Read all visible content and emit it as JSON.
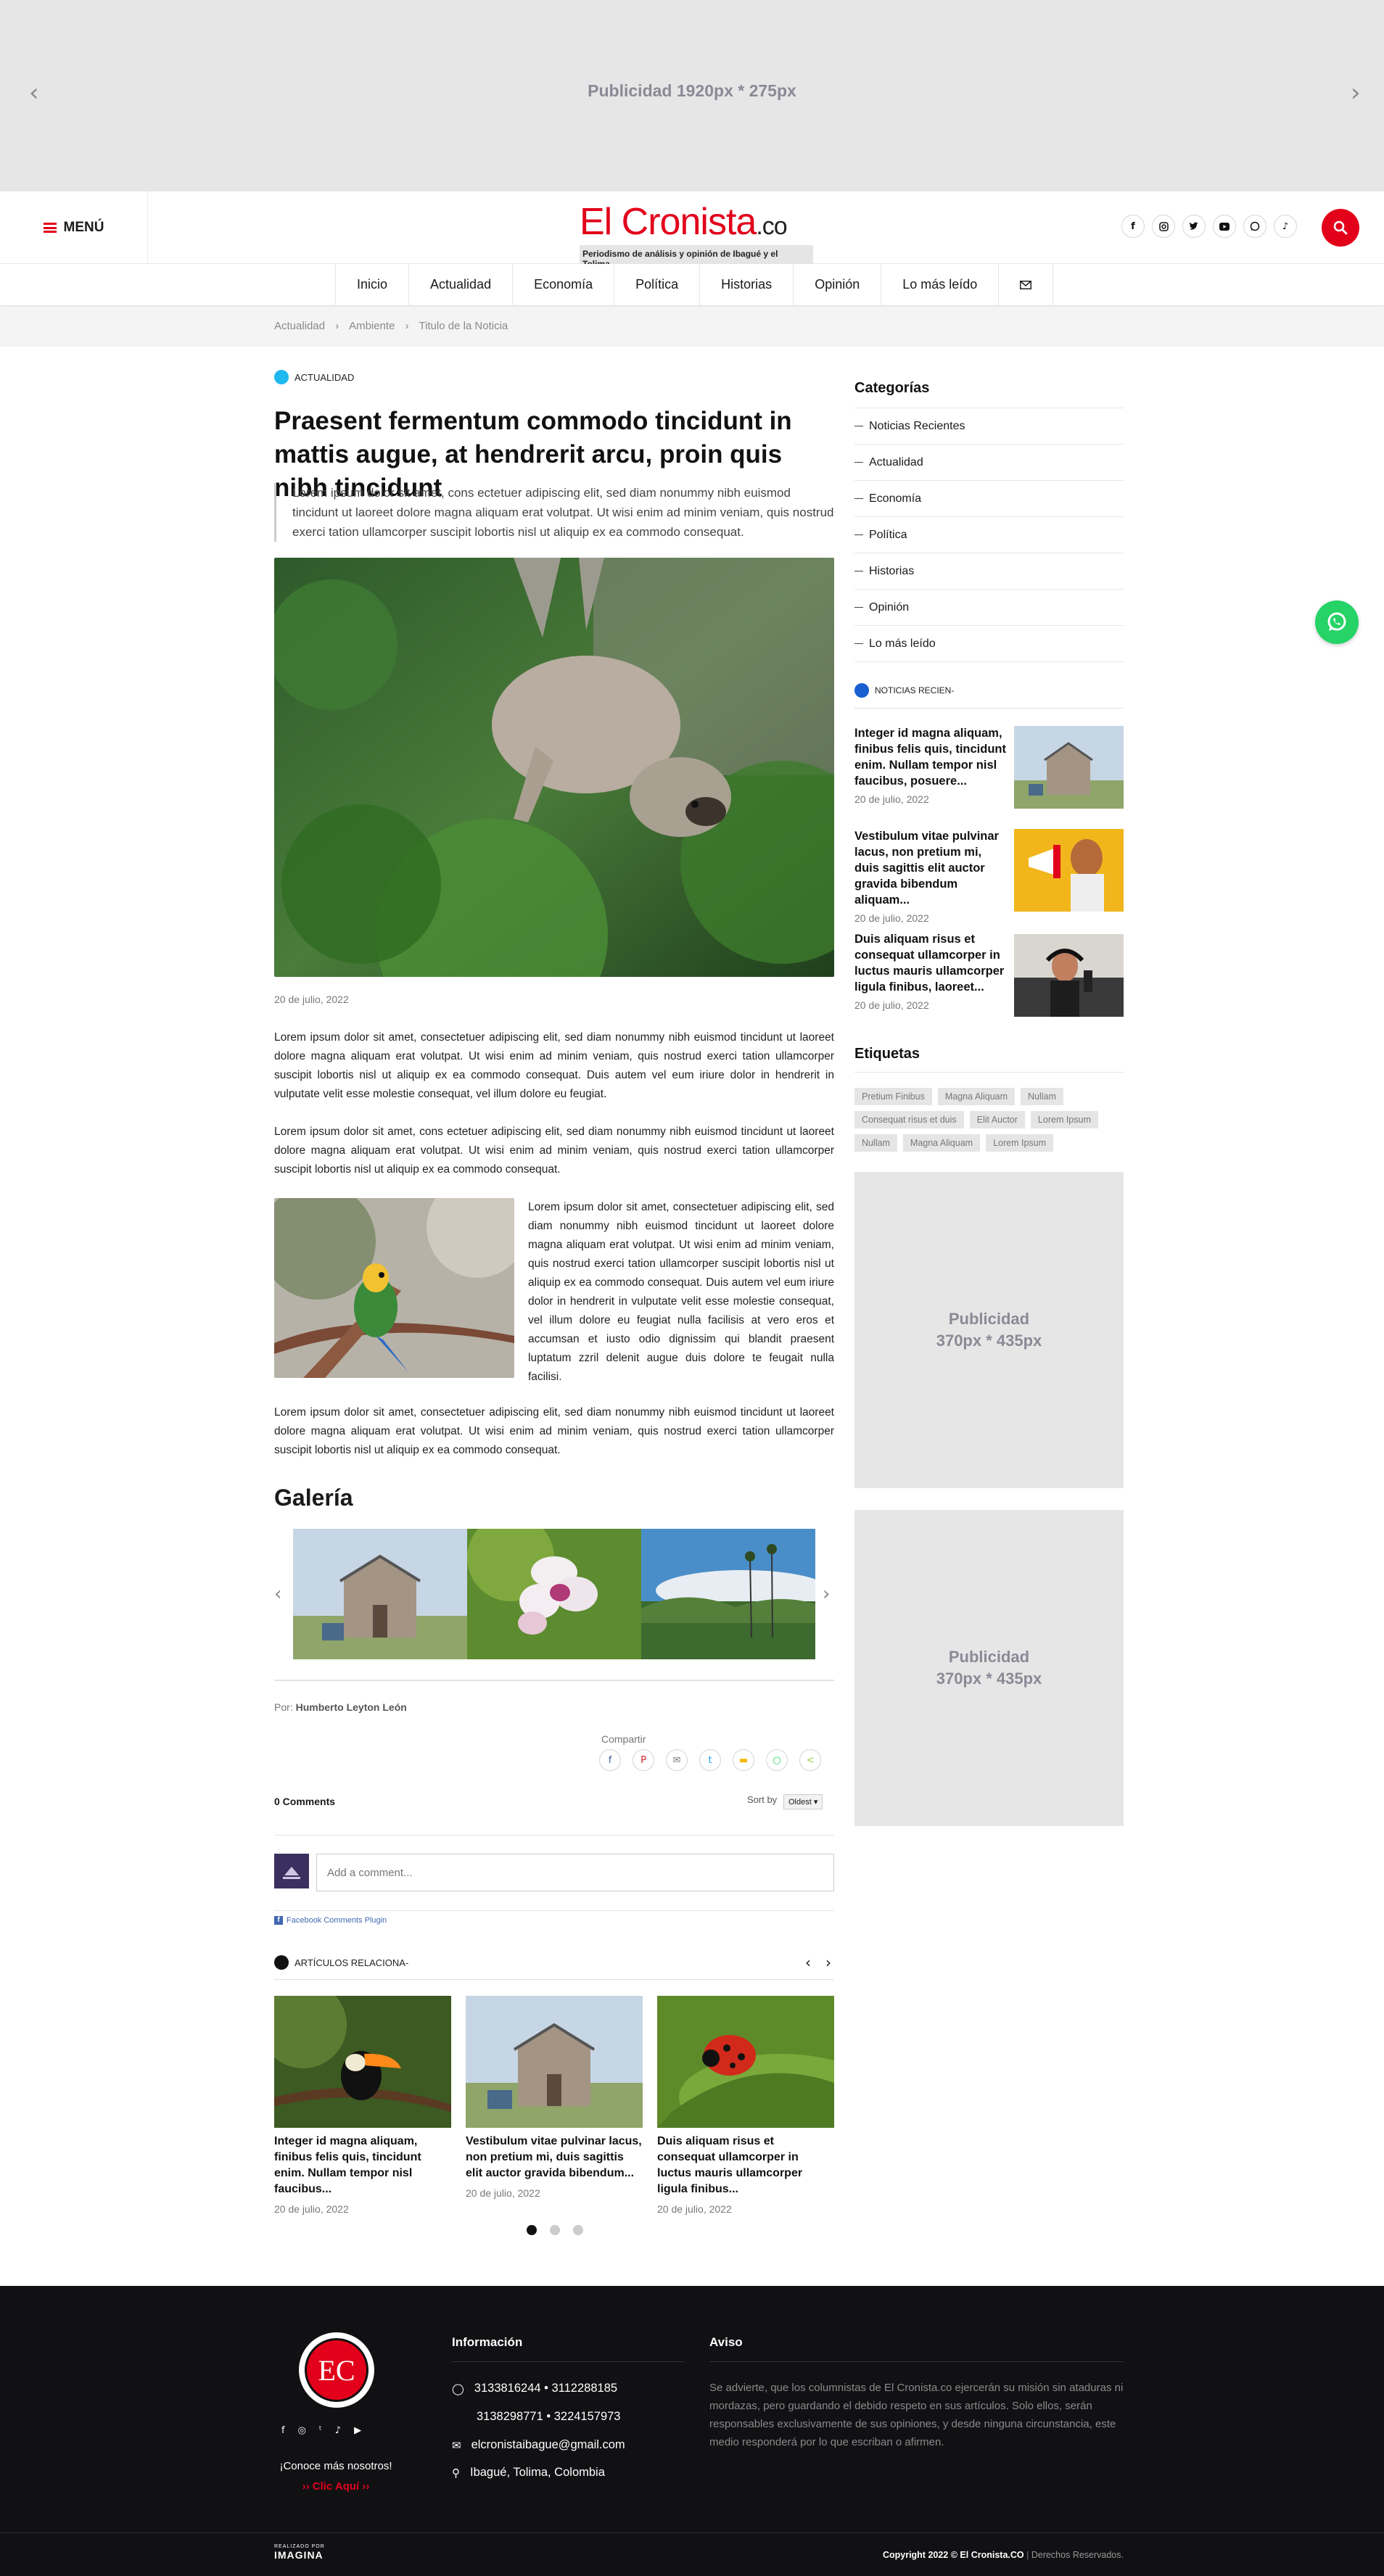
{
  "top_ad": {
    "text": "Publicidad 1920px * 275px",
    "prev": "‹",
    "next": "›"
  },
  "header": {
    "menu_label": "MENÚ",
    "logo_main": "El Cronista",
    "logo_suffix": ".co",
    "logo_tagline": "Periodismo de análisis y opinión de Ibagué y el Tolima",
    "social_icons": [
      "facebook-icon",
      "instagram-icon",
      "twitter-icon",
      "youtube-icon",
      "whatsapp-icon",
      "tiktok-icon"
    ]
  },
  "nav": {
    "items": [
      "Inicio",
      "Actualidad",
      "Economía",
      "Política",
      "Historias",
      "Opinión",
      "Lo más leído"
    ]
  },
  "breadcrumb": [
    "Actualidad",
    "Ambiente",
    "Titulo de la Noticia"
  ],
  "article": {
    "category": "ACTUALIDAD",
    "title": "Praesent fermentum commodo tincidunt in mattis augue, at hendrerit arcu, proin quis nibh tincidunt",
    "lead": "Lorem ipsum dolor sit amet, cons ectetuer adipiscing elit, sed diam nonummy nibh euismod tincidunt ut laoreet dolore magna aliquam erat volutpat. Ut wisi enim ad minim veniam, quis nostrud exerci tation ullamcorper suscipit lobortis nisl ut aliquip ex ea commodo consequat.",
    "date": "20 de julio, 2022",
    "p1": "Lorem ipsum dolor sit amet, consectetuer adipiscing elit, sed diam nonummy nibh euismod tincidunt ut laoreet dolore magna aliquam erat volutpat. Ut wisi enim ad minim veniam, quis nostrud exerci tation ullamcorper suscipit lobortis nisl ut aliquip ex ea commodo consequat. Duis autem vel eum iriure dolor in hendrerit in vulputate velit esse molestie consequat, vel illum dolore eu feugiat.",
    "p2": "Lorem ipsum dolor sit amet, cons ectetuer adipiscing elit, sed diam nonummy nibh euismod tincidunt ut laoreet dolore magna aliquam erat volutpat. Ut wisi enim ad minim veniam, quis nostrud exerci tation ullamcorper suscipit lobortis nisl ut aliquip ex ea commodo consequat.",
    "p3": "Lorem ipsum dolor sit amet, consectetuer adipiscing elit, sed diam nonummy nibh euismod tincidunt ut laoreet dolore magna aliquam erat volutpat. Ut wisi enim ad minim veniam, quis nostrud exerci tation ullamcorper suscipit lobortis nisl ut aliquip ex ea commodo consequat. Duis autem vel eum iriure dolor in hendrerit in vulputate velit esse molestie consequat, vel illum dolore eu feugiat nulla facilisis at vero eros et accumsan et iusto odio dignissim qui blandit praesent luptatum zzril delenit augue duis dolore te feugait nulla facilisi.",
    "p4": "Lorem ipsum dolor sit amet, consectetuer adipiscing elit, sed diam nonummy nibh euismod tincidunt ut laoreet dolore magna aliquam erat volutpat. Ut wisi enim ad minim veniam, quis nostrud exerci tation ullamcorper suscipit lobortis nisl ut aliquip ex ea commodo consequat.",
    "gallery_title": "Galería",
    "author_prefix": "Por:",
    "author": "Humberto Leyton León",
    "share_label": "Compartir"
  },
  "comments": {
    "count": "0 Comments",
    "sort_label": "Sort by",
    "sort_value": "Oldest",
    "placeholder": "Add a comment...",
    "plugin": "Facebook Comments Plugin"
  },
  "related": {
    "label": "ARTÍCULOS RELACIONA-",
    "items": [
      {
        "title": "Integer id magna aliquam, finibus felis quis, tincidunt enim. Nullam tempor nisl faucibus...",
        "date": "20 de julio, 2022"
      },
      {
        "title": "Vestibulum vitae pulvinar lacus, non pretium mi, duis sagittis elit auctor gravida bibendum...",
        "date": "20 de julio, 2022"
      },
      {
        "title": "Duis aliquam risus et consequat ullamcorper in luctus mauris ullamcorper ligula finibus...",
        "date": "20 de julio, 2022"
      }
    ]
  },
  "sidebar": {
    "categories_title": "Categorías",
    "categories": [
      "Noticias Recientes",
      "Actualidad",
      "Economía",
      "Política",
      "Historias",
      "Opinión",
      "Lo más leído"
    ],
    "recent_label": "NOTICIAS RECIEN-",
    "recent": [
      {
        "title": "Integer id magna aliquam, finibus felis quis, tincidunt enim. Nullam tempor nisl faucibus, posuere...",
        "date": "20 de julio, 2022"
      },
      {
        "title": "Vestibulum vitae pulvinar lacus, non pretium mi, duis sagittis elit auctor gravida bibendum aliquam...",
        "date": "20 de julio, 2022"
      },
      {
        "title": "Duis aliquam risus et consequat ullamcorper in luctus mauris ullamcorper ligula finibus, laoreet...",
        "date": "20 de julio, 2022"
      }
    ],
    "tags_title": "Etiquetas",
    "tags": [
      "Pretium Finibus",
      "Magna Aliquam",
      "Nullam",
      "Consequat risus et duis",
      "Elit Auctor",
      "Lorem Ipsum",
      "Nullam",
      "Magna Aliquam",
      "Lorem Ipsum"
    ],
    "ad1": [
      "Publicidad",
      "370px * 435px"
    ],
    "ad2": [
      "Publicidad",
      "370px * 435px"
    ]
  },
  "footer": {
    "logo": "EC",
    "conoce": "¡Conoce más nosotros!",
    "clic": "›› Clic Aquí ››",
    "info_title": "Información",
    "phones1": "3133816244  •  3112288185",
    "phones2": "3138298771  •  3224157973",
    "email": "elcronistaibague@gmail.com",
    "location": "Ibagué, Tolima, Colombia",
    "aviso_title": "Aviso",
    "aviso_text": "Se advierte, que los columnistas de El Cronista.co ejercerán su misión sin ataduras ni mordazas, pero guardando el debido respeto en sus artículos. Solo ellos, serán responsables exclusivamente de sus opiniones, y desde ninguna circunstancia, este medio responderá por lo que escriban o afirmen.",
    "made_by": "REALIZADO POR",
    "made_brand": "IMAGINA",
    "copyright": "Copyright 2022 © El Cronista.CO",
    "rights": "Derechos Reservados."
  },
  "colors": {
    "brand_red": "#e2001a",
    "category_blue": "#1fb9f0",
    "whatsapp": "#25d366",
    "footer_bg": "#111114"
  }
}
